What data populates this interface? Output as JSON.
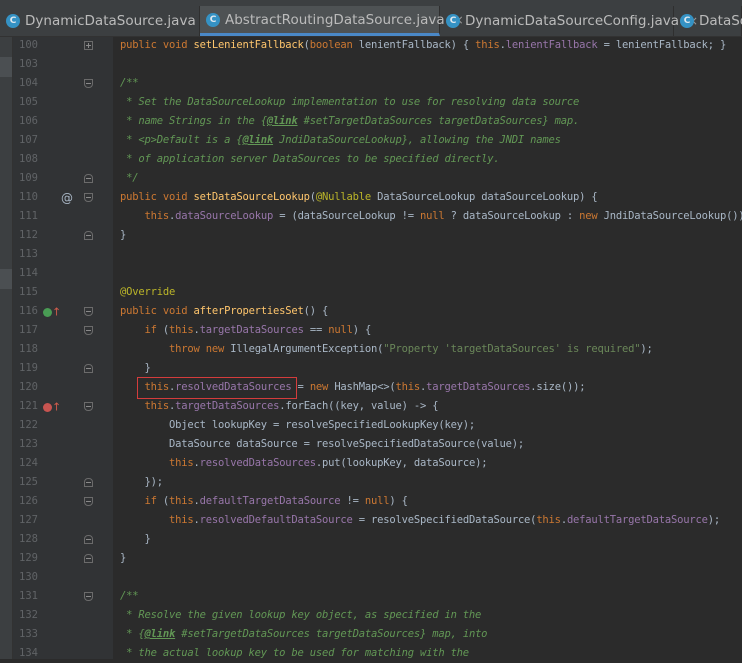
{
  "tabs": [
    {
      "label": "DynamicDataSource.java",
      "icon": "class-icon",
      "active": false,
      "closable": true
    },
    {
      "label": "AbstractRoutingDataSource.java",
      "icon": "class-icon",
      "active": true,
      "closable": true
    },
    {
      "label": "DynamicDataSourceConfig.java",
      "icon": "class-icon",
      "active": false,
      "closable": true
    },
    {
      "label": "DataSo",
      "icon": "class-icon",
      "active": false,
      "closable": false
    }
  ],
  "tab_icon_glyph": "C",
  "tab_close_glyph": "×",
  "colors": {
    "keyword": "#cc7832",
    "comment": "#629755",
    "field": "#9876aa",
    "string": "#6a8759",
    "method": "#ffc66d",
    "annotation": "#bbb529",
    "highlight_box": "#d43c3c"
  },
  "lines": [
    {
      "no": "100",
      "fold": "plus",
      "code": [
        [
          "kw",
          "public void "
        ],
        [
          "fn",
          "setLenientFallback"
        ],
        [
          "p",
          "("
        ],
        [
          "kw",
          "boolean "
        ],
        [
          "p",
          "lenientFallback) { "
        ],
        [
          "kw",
          "this"
        ],
        [
          "p",
          "."
        ],
        [
          "fld",
          "lenientFallback"
        ],
        [
          "p",
          " = lenientFallback; }"
        ]
      ]
    },
    {
      "no": "103",
      "code": []
    },
    {
      "no": "104",
      "fold": "open",
      "code": [
        [
          "cm",
          "/**"
        ]
      ]
    },
    {
      "no": "105",
      "code": [
        [
          "cm",
          " * Set the DataSourceLookup implementation to use for resolving data source"
        ]
      ]
    },
    {
      "no": "106",
      "code": [
        [
          "cm",
          " * name Strings in the {"
        ],
        [
          "tag",
          "@link"
        ],
        [
          "cm",
          " #setTargetDataSources targetDataSources} map."
        ]
      ]
    },
    {
      "no": "107",
      "code": [
        [
          "cm",
          " * <p>Default is a {"
        ],
        [
          "tag",
          "@link"
        ],
        [
          "cm",
          " JndiDataSourceLookup}, allowing the JNDI names"
        ]
      ]
    },
    {
      "no": "108",
      "code": [
        [
          "cm",
          " * of application server DataSources to be specified directly."
        ]
      ]
    },
    {
      "no": "109",
      "fold": "close",
      "code": [
        [
          "cm",
          " */"
        ]
      ]
    },
    {
      "no": "110",
      "fold": "open",
      "gicon": "at",
      "code": [
        [
          "kw",
          "public void "
        ],
        [
          "fn",
          "setDataSourceLookup"
        ],
        [
          "p",
          "("
        ],
        [
          "ann",
          "@Nullable "
        ],
        [
          "p",
          "DataSourceLookup dataSourceLookup) {"
        ]
      ]
    },
    {
      "no": "111",
      "code": [
        [
          "p",
          "    "
        ],
        [
          "kw",
          "this"
        ],
        [
          "p",
          "."
        ],
        [
          "fld",
          "dataSourceLookup"
        ],
        [
          "p",
          " = (dataSourceLookup != "
        ],
        [
          "kw",
          "null "
        ],
        [
          "p",
          "? dataSourceLookup : "
        ],
        [
          "kw",
          "new "
        ],
        [
          "p",
          "JndiDataSourceLookup());"
        ]
      ]
    },
    {
      "no": "112",
      "fold": "close",
      "code": [
        [
          "p",
          "}"
        ]
      ]
    },
    {
      "no": "113",
      "code": []
    },
    {
      "no": "114",
      "code": []
    },
    {
      "no": "115",
      "code": [
        [
          "ann",
          "@Override"
        ]
      ]
    },
    {
      "no": "116",
      "fold": "open",
      "gicon": "implements",
      "code": [
        [
          "kw",
          "public void "
        ],
        [
          "fn",
          "afterPropertiesSet"
        ],
        [
          "p",
          "() {"
        ]
      ]
    },
    {
      "no": "117",
      "fold": "open",
      "code": [
        [
          "p",
          "    "
        ],
        [
          "kw",
          "if "
        ],
        [
          "p",
          "("
        ],
        [
          "kw",
          "this"
        ],
        [
          "p",
          "."
        ],
        [
          "fld",
          "targetDataSources"
        ],
        [
          "p",
          " == "
        ],
        [
          "kw",
          "null"
        ],
        [
          "p",
          ") {"
        ]
      ]
    },
    {
      "no": "118",
      "code": [
        [
          "p",
          "        "
        ],
        [
          "kw",
          "throw new "
        ],
        [
          "p",
          "IllegalArgumentException("
        ],
        [
          "str",
          "\"Property 'targetDataSources' is required\""
        ],
        [
          "p",
          ");"
        ]
      ]
    },
    {
      "no": "119",
      "fold": "close",
      "code": [
        [
          "p",
          "    }"
        ]
      ]
    },
    {
      "no": "120",
      "code": [
        [
          "p",
          "    "
        ],
        [
          "kw",
          "this"
        ],
        [
          "p",
          "."
        ],
        [
          "fld",
          "resolvedDataSources"
        ],
        [
          "p",
          " = "
        ],
        [
          "kw",
          "new "
        ],
        [
          "p",
          "HashMap<>("
        ],
        [
          "kw",
          "this"
        ],
        [
          "p",
          "."
        ],
        [
          "fld",
          "targetDataSources"
        ],
        [
          "p",
          ".size());"
        ]
      ]
    },
    {
      "no": "121",
      "fold": "open",
      "gicon": "lambda",
      "code": [
        [
          "p",
          "    "
        ],
        [
          "kw",
          "this"
        ],
        [
          "p",
          "."
        ],
        [
          "fld",
          "targetDataSources"
        ],
        [
          "p",
          ".forEach((key, value) -> {"
        ]
      ]
    },
    {
      "no": "122",
      "code": [
        [
          "p",
          "        Object lookupKey = resolveSpecifiedLookupKey(key);"
        ]
      ]
    },
    {
      "no": "123",
      "code": [
        [
          "p",
          "        DataSource dataSource = resolveSpecifiedDataSource(value);"
        ]
      ]
    },
    {
      "no": "124",
      "code": [
        [
          "p",
          "        "
        ],
        [
          "kw",
          "this"
        ],
        [
          "p",
          "."
        ],
        [
          "fld",
          "resolvedDataSources"
        ],
        [
          "p",
          ".put(lookupKey, dataSource);"
        ]
      ]
    },
    {
      "no": "125",
      "fold": "close",
      "code": [
        [
          "p",
          "    });"
        ]
      ]
    },
    {
      "no": "126",
      "fold": "open",
      "code": [
        [
          "p",
          "    "
        ],
        [
          "kw",
          "if "
        ],
        [
          "p",
          "("
        ],
        [
          "kw",
          "this"
        ],
        [
          "p",
          "."
        ],
        [
          "fld",
          "defaultTargetDataSource"
        ],
        [
          "p",
          " != "
        ],
        [
          "kw",
          "null"
        ],
        [
          "p",
          ") {"
        ]
      ]
    },
    {
      "no": "127",
      "code": [
        [
          "p",
          "        "
        ],
        [
          "kw",
          "this"
        ],
        [
          "p",
          "."
        ],
        [
          "fld",
          "resolvedDefaultDataSource"
        ],
        [
          "p",
          " = resolveSpecifiedDataSource("
        ],
        [
          "kw",
          "this"
        ],
        [
          "p",
          "."
        ],
        [
          "fld",
          "defaultTargetDataSource"
        ],
        [
          "p",
          ");"
        ]
      ]
    },
    {
      "no": "128",
      "fold": "close",
      "code": [
        [
          "p",
          "    }"
        ]
      ]
    },
    {
      "no": "129",
      "fold": "close",
      "code": [
        [
          "p",
          "}"
        ]
      ]
    },
    {
      "no": "130",
      "code": []
    },
    {
      "no": "131",
      "fold": "open",
      "code": [
        [
          "cm",
          "/**"
        ]
      ]
    },
    {
      "no": "132",
      "code": [
        [
          "cm",
          " * Resolve the given lookup key object, as specified in the"
        ]
      ]
    },
    {
      "no": "133",
      "code": [
        [
          "cm",
          " * {"
        ],
        [
          "tag",
          "@link"
        ],
        [
          "cm",
          " #setTargetDataSources targetDataSources} map, into"
        ]
      ]
    },
    {
      "no": "134",
      "code": [
        [
          "cm",
          " * the actual lookup key to be used for matching with the"
        ]
      ]
    }
  ],
  "gutter_icons": {
    "at": "@",
    "implements": "↑",
    "lambda": "↑"
  }
}
